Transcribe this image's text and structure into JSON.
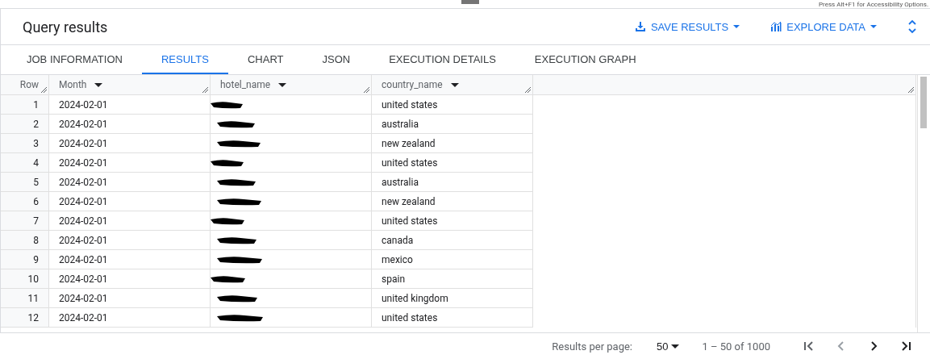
{
  "top_bar": {
    "hint": "Press Alt+F1 for Accessibility Options."
  },
  "header": {
    "title": "Query results",
    "actions": [
      {
        "label": "SAVE RESULTS",
        "kind": "save"
      },
      {
        "label": "EXPLORE DATA",
        "kind": "explore"
      }
    ]
  },
  "tabs": [
    {
      "label": "JOB INFORMATION",
      "selected": false
    },
    {
      "label": "RESULTS",
      "selected": true
    },
    {
      "label": "CHART",
      "selected": false
    },
    {
      "label": "JSON",
      "selected": false
    },
    {
      "label": "EXECUTION DETAILS",
      "selected": false
    },
    {
      "label": "EXECUTION GRAPH",
      "selected": false
    }
  ],
  "table": {
    "columns": [
      {
        "label": "Row",
        "sortable": false
      },
      {
        "label": "Month",
        "sortable": true
      },
      {
        "label": "hotel_name",
        "sortable": true
      },
      {
        "label": "country_name",
        "sortable": true
      }
    ],
    "rows": [
      {
        "row": "1",
        "month": "2024-02-01",
        "country": "united states"
      },
      {
        "row": "2",
        "month": "2024-02-01",
        "country": "australia"
      },
      {
        "row": "3",
        "month": "2024-02-01",
        "country": "new zealand"
      },
      {
        "row": "4",
        "month": "2024-02-01",
        "country": "united states"
      },
      {
        "row": "5",
        "month": "2024-02-01",
        "country": "australia"
      },
      {
        "row": "6",
        "month": "2024-02-01",
        "country": "new zealand"
      },
      {
        "row": "7",
        "month": "2024-02-01",
        "country": "united states"
      },
      {
        "row": "8",
        "month": "2024-02-01",
        "country": "canada"
      },
      {
        "row": "9",
        "month": "2024-02-01",
        "country": "mexico"
      },
      {
        "row": "10",
        "month": "2024-02-01",
        "country": "spain"
      },
      {
        "row": "11",
        "month": "2024-02-01",
        "country": "united kingdom"
      },
      {
        "row": "12",
        "month": "2024-02-01",
        "country": "united states"
      }
    ]
  },
  "pagination": {
    "label": "Results per page:",
    "page_size": "50",
    "range": "1 – 50 of 1000"
  }
}
